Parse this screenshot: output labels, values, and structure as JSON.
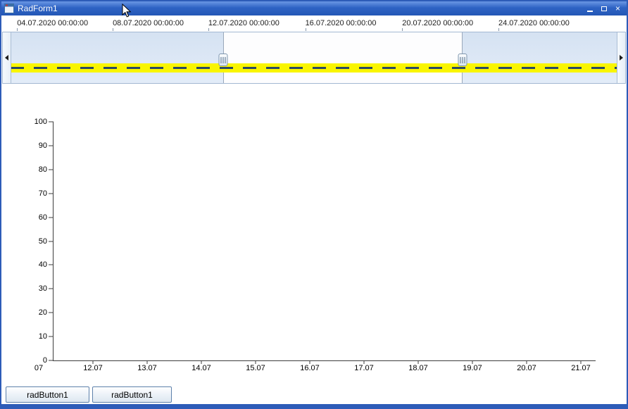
{
  "window": {
    "title": "RadForm1",
    "close_glyph": "×",
    "border_color": "#2d5cb8"
  },
  "navigator": {
    "ruler_labels": [
      {
        "text": "04.07.2020 00:00:00",
        "left_pct": 2.5
      },
      {
        "text": "08.07.2020 00:00:00",
        "left_pct": 17.8
      },
      {
        "text": "12.07.2020 00:00:00",
        "left_pct": 33.1
      },
      {
        "text": "16.07.2020 00:00:00",
        "left_pct": 48.6
      },
      {
        "text": "20.07.2020 00:00:00",
        "left_pct": 64.1
      },
      {
        "text": "24.07.2020 00:00:00",
        "left_pct": 79.5
      }
    ],
    "selection_start_pct": 35.4,
    "selection_end_pct": 73.9,
    "band_color": "#f9f500",
    "dash_color": "#2c4a63",
    "preview_series": {
      "type": "line",
      "style": "dashed",
      "shape": "flat-horizontal-line",
      "highlighted": true
    }
  },
  "chart_data": {
    "type": "line",
    "title": "",
    "x_tick_labels": [
      "07",
      "12.07",
      "13.07",
      "14.07",
      "15.07",
      "16.07",
      "17.07",
      "18.07",
      "19.07",
      "20.07",
      "21.07"
    ],
    "y_tick_labels": [
      "100",
      "90",
      "80",
      "70",
      "60",
      "50",
      "40",
      "30",
      "20",
      "10",
      "0"
    ],
    "ylim": [
      0,
      100
    ],
    "series": [],
    "grid": false,
    "legend": "none"
  },
  "buttons": [
    {
      "label": "radButton1"
    },
    {
      "label": "radButton1"
    }
  ]
}
